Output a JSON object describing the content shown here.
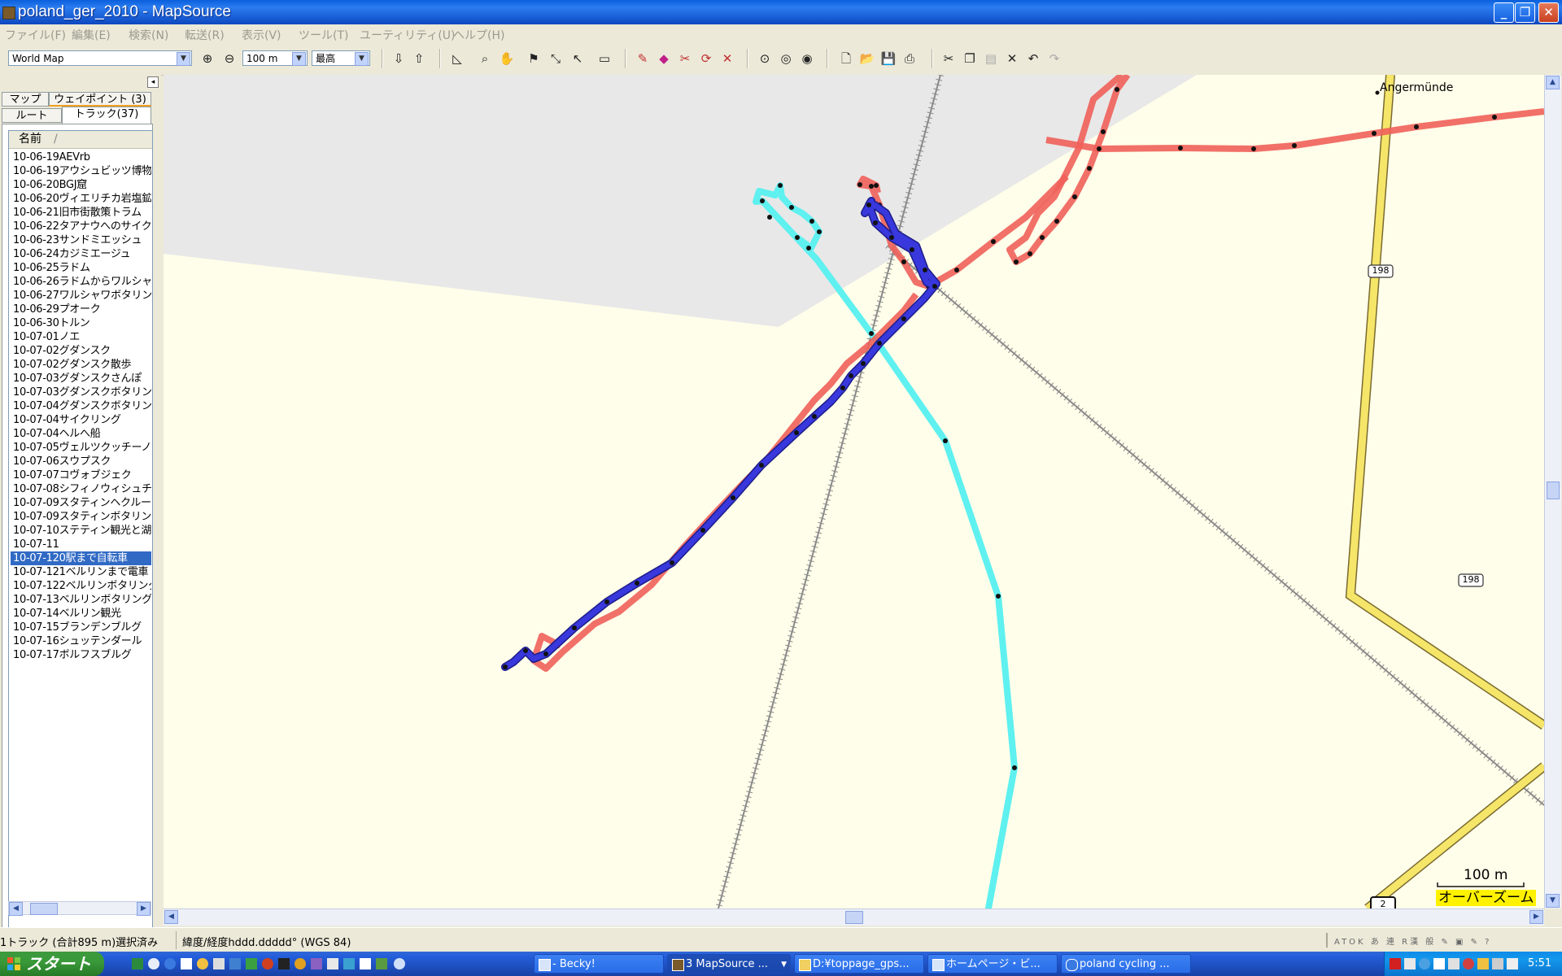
{
  "window": {
    "title": "poland_ger_2010 - MapSource",
    "buttons": {
      "minimize": "_",
      "maximize": "❐",
      "close": "✕"
    }
  },
  "menu": [
    "ファイル(F)",
    "編集(E)",
    "検索(N)",
    "転送(R)",
    "表示(V)",
    "ツール(T)",
    "ユーティリティ(U)",
    "ヘルプ(H)"
  ],
  "toolbar": {
    "map_product": "World Map",
    "zoom_scale": "100 m",
    "detail": "最高"
  },
  "panel": {
    "tabs": {
      "map": "マップ",
      "waypoints": "ウェイポイント (3)",
      "routes": "ルート",
      "tracks": "トラック(37)"
    },
    "column_header": "名前",
    "sort_indicator": "/",
    "tracks": [
      "10-06-19AEVrb",
      "10-06-19アウシュビッツ博物",
      "10-06-20BGJ窟",
      "10-06-20ヴィエリチカ岩塩鉱",
      "10-06-21旧市街散策トラム",
      "10-06-22タアナウへのサイク",
      "10-06-23サンドミエッシュ",
      "10-06-24カジミエージュ",
      "10-06-25ラドム",
      "10-06-26ラドムからワルシャ",
      "10-06-27ワルシャワボタリング",
      "10-06-29プオーク",
      "10-06-30トルン",
      "10-07-01ノエ",
      "10-07-02グダンスク",
      "10-07-02グダンスク散歩",
      "10-07-03グダンスクさんぽ",
      "10-07-03グダンスクボタリング",
      "10-07-04グダンスクボタリング",
      "10-07-04サイクリング",
      "10-07-04ヘルへ船",
      "10-07-05ヴェルツクッチーノ",
      "10-07-06スウプスク",
      "10-07-07コヴォブジェク",
      "10-07-08シフィノウィシュチャ",
      "10-07-09スタティンヘクルージ",
      "10-07-09スタティンボタリング",
      "10-07-10ステティン観光と湖",
      "10-07-11",
      "10-07-120駅まで自転車",
      "10-07-121ベルリンまで電車",
      "10-07-122ベルリンボタリング",
      "10-07-13ベルリンボタリング",
      "10-07-14ベルリン観光",
      "10-07-15ブランデンブルグ",
      "10-07-16シュッテンダール",
      "10-07-17ボルフスブルグ"
    ],
    "selected_index": 29
  },
  "map": {
    "place_label": "Angermünde",
    "road_labels": [
      "198",
      "198",
      "2"
    ],
    "scale_text": "100 m",
    "overzoom_text": "オーバーズーム",
    "colors": {
      "background": "#fffeea",
      "gray_area": "#e8e8e8",
      "selected_track": "#3535d4",
      "red_track": "#f0605a",
      "cyan_track": "#5ff0f0",
      "road": "#f5e66a"
    }
  },
  "status": {
    "selection": "1トラック (合計895 m)選択済み",
    "coord_format": "緯度/経度hddd.ddddd° (WGS 84)"
  },
  "taskbar": {
    "start": "スタート",
    "tasks": [
      "- Becky!",
      "3 MapSource ...",
      "D:¥toppage_gps...",
      "ホームページ・ビ...",
      "poland cycling ..."
    ],
    "clock": "5:51"
  }
}
